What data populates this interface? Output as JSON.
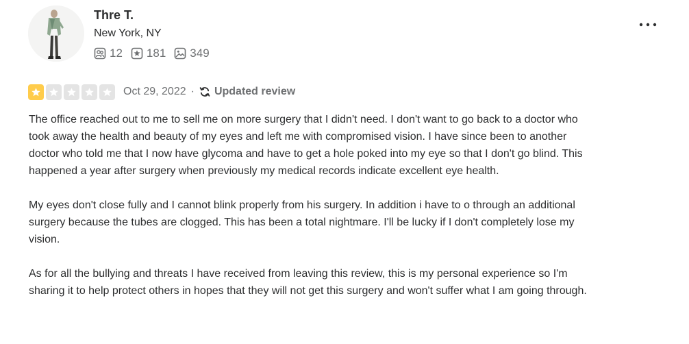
{
  "user": {
    "name": "Thre T.",
    "location": "New York, NY",
    "stats": {
      "friends": "12",
      "reviews": "181",
      "photos": "349"
    }
  },
  "review": {
    "rating": 1,
    "rating_max": 5,
    "date": "Oct 29, 2022",
    "separator": "·",
    "updated_label": "Updated review",
    "paragraphs": [
      "The office reached out to me to sell me on more surgery that I didn't need. I don't want to go back to a doctor who took away the health and beauty of my eyes and left me with compromised vision. I have since been to another doctor who told me that I now have glycoma and have to get a hole poked into my eye so that I don't go blind. This happened a year after surgery when previously my medical records indicate excellent eye health.",
      "My eyes don't close fully and I cannot blink properly from his surgery. In addition i have to o through an additional surgery because the tubes are clogged. This has been a total nightmare. I'll be lucky if I don't completely lose my vision.",
      "As for all the bullying and threats I have received from leaving this review, this is my personal experience so I'm sharing it to help protect others in hopes that they will not get this surgery and won't suffer what I am going through."
    ]
  },
  "icons": {
    "friends": "friends-icon",
    "reviews": "star-badge-icon",
    "photos": "photo-icon",
    "more": "more-options-icon",
    "updated": "refresh-icon"
  },
  "colors": {
    "star_filled": "#ffcc4b",
    "star_empty": "#e4e4e4",
    "text_primary": "#2d2e2f",
    "text_secondary": "#6e7072"
  }
}
